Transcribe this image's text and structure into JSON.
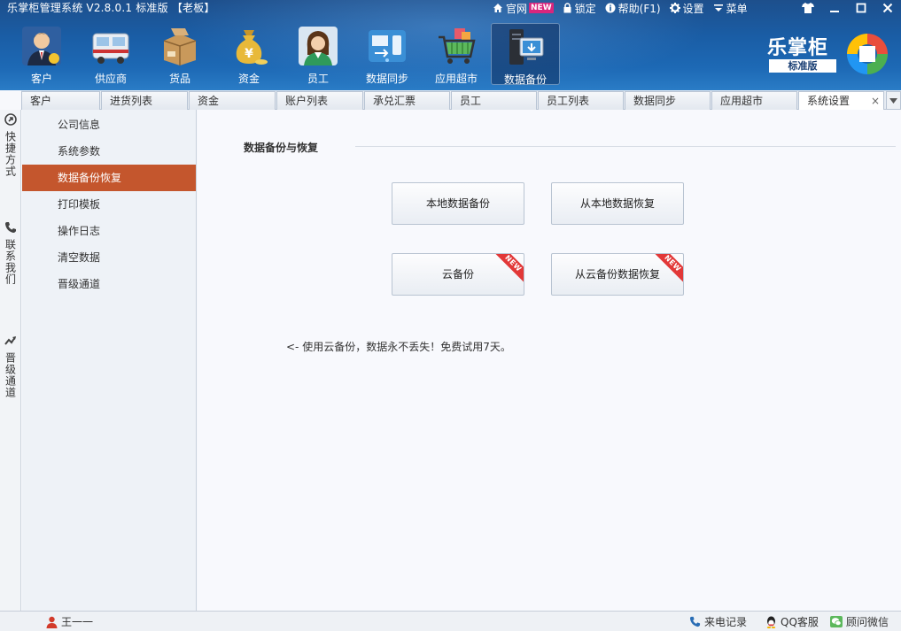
{
  "window": {
    "title": "乐掌柜管理系统 V2.8.0.1 标准版 【老板】",
    "links": [
      {
        "label": "官网",
        "icon": "home-icon",
        "badge": "NEW"
      },
      {
        "label": "锁定",
        "icon": "lock-icon"
      },
      {
        "label": "帮助(F1)",
        "icon": "help-icon"
      },
      {
        "label": "设置",
        "icon": "gear-icon"
      },
      {
        "label": "菜单",
        "icon": "menu-icon"
      }
    ]
  },
  "toolbar": [
    {
      "label": "客户",
      "icon": "customer-icon"
    },
    {
      "label": "供应商",
      "icon": "supplier-truck-icon"
    },
    {
      "label": "货品",
      "icon": "goods-box-icon"
    },
    {
      "label": "资金",
      "icon": "money-bag-icon"
    },
    {
      "label": "员工",
      "icon": "employee-icon"
    },
    {
      "label": "数据同步",
      "icon": "data-sync-icon"
    },
    {
      "label": "应用超市",
      "icon": "app-market-cart-icon"
    },
    {
      "label": "数据备份",
      "icon": "data-backup-icon",
      "active": true
    }
  ],
  "brand": {
    "name": "乐掌柜",
    "edition": "标准版"
  },
  "tabs": [
    {
      "label": "客户"
    },
    {
      "label": "进货列表"
    },
    {
      "label": "资金"
    },
    {
      "label": "账户列表"
    },
    {
      "label": "承兑汇票"
    },
    {
      "label": "员工"
    },
    {
      "label": "员工列表"
    },
    {
      "label": "数据同步"
    },
    {
      "label": "应用超市"
    },
    {
      "label": "系统设置",
      "active": true,
      "close": "×"
    }
  ],
  "side_strip": [
    {
      "label": "快捷方式",
      "icon": "shortcut-icon"
    },
    {
      "label": "联系我们",
      "icon": "phone-icon"
    },
    {
      "label": "晋级通道",
      "icon": "trend-icon"
    }
  ],
  "menu": [
    {
      "label": "公司信息"
    },
    {
      "label": "系统参数"
    },
    {
      "label": "数据备份恢复",
      "active": true
    },
    {
      "label": "打印模板"
    },
    {
      "label": "操作日志"
    },
    {
      "label": "清空数据"
    },
    {
      "label": "晋级通道"
    }
  ],
  "main": {
    "section_title": "数据备份与恢复",
    "buttons": [
      {
        "label": "本地数据备份"
      },
      {
        "label": "从本地数据恢复"
      },
      {
        "label": "云备份",
        "badge": "NEW"
      },
      {
        "label": "从云备份数据恢复",
        "badge": "NEW"
      }
    ],
    "tip": "<- 使用云备份，数据永不丢失！免费试用7天。"
  },
  "status": {
    "user": "王一一",
    "items": [
      {
        "label": "来电记录",
        "icon": "phone-icon"
      },
      {
        "label": "QQ客服",
        "icon": "qq-icon"
      },
      {
        "label": "顾问微信",
        "icon": "wechat-icon"
      }
    ]
  },
  "colors": {
    "accent": "#c4562d",
    "header": "#1d5a9e",
    "new_badge": "#e23838"
  }
}
